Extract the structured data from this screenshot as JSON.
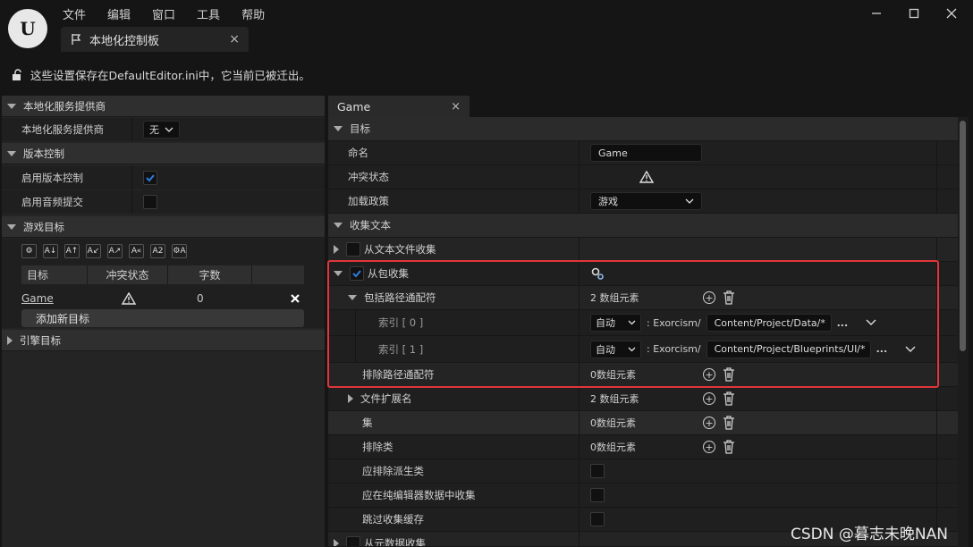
{
  "logo": {
    "glyph": "U"
  },
  "menu": [
    "文件",
    "编辑",
    "窗口",
    "工具",
    "帮助"
  ],
  "tab": {
    "label": "本地化控制板",
    "close": "×"
  },
  "notice": "这些设置保存在DefaultEditor.ini中，它当前已被迁出。",
  "left": {
    "sections": {
      "provider": "本地化服务提供商",
      "vcs": "版本控制",
      "game_targets": "游戏目标",
      "engine_targets": "引擎目标"
    },
    "provider_label": "本地化服务提供商",
    "provider_value": "无",
    "vcs_enable": "启用版本控制",
    "vcs_enable_checked": true,
    "auto_submit": "启用音频提交",
    "auto_submit_checked": false,
    "table_headers": [
      "目标",
      "冲突状态",
      "字数"
    ],
    "target_row": {
      "name": "Game",
      "count": "0"
    },
    "add_button": "添加新目标"
  },
  "right": {
    "tab": "Game",
    "tab_close": "×",
    "rows": {
      "target_hdr": "目标",
      "name_lbl": "命名",
      "name_val": "Game",
      "conflict_lbl": "冲突状态",
      "load_lbl": "加载政策",
      "load_val": "游戏",
      "gather_hdr": "收集文本",
      "from_text": "从文本文件收集",
      "from_pkg": "从包收集",
      "incl_lbl": "包括路径通配符",
      "incl_val": "2 数组元素",
      "idx0": "索引 [ 0 ]",
      "idx1": "索引 [ 1 ]",
      "auto": "自动",
      "prefix": ": Exorcism/",
      "path0": "Content/Project/Data/*",
      "path1": "Content/Project/Blueprints/UI/*",
      "more": "...",
      "excl_lbl": "排除路径通配符",
      "excl_val": "0数组元素",
      "ext_lbl": "文件扩展名",
      "ext_val": "2 数组元素",
      "set_lbl": "集",
      "set_val": "0数组元素",
      "excl_cls_lbl": "排除类",
      "excl_cls_val": "0数组元素",
      "derived_lbl": "应排除派生类",
      "editor_lbl": "应在纯编辑器数据中收集",
      "skip_lbl": "跳过收集缓存",
      "meta_lbl": "从元数据收集"
    }
  },
  "watermark": "CSDN @暮志未晚NAN",
  "colors": {
    "highlight": "#e0363a",
    "checkbox_accent": "#2f7de1"
  }
}
